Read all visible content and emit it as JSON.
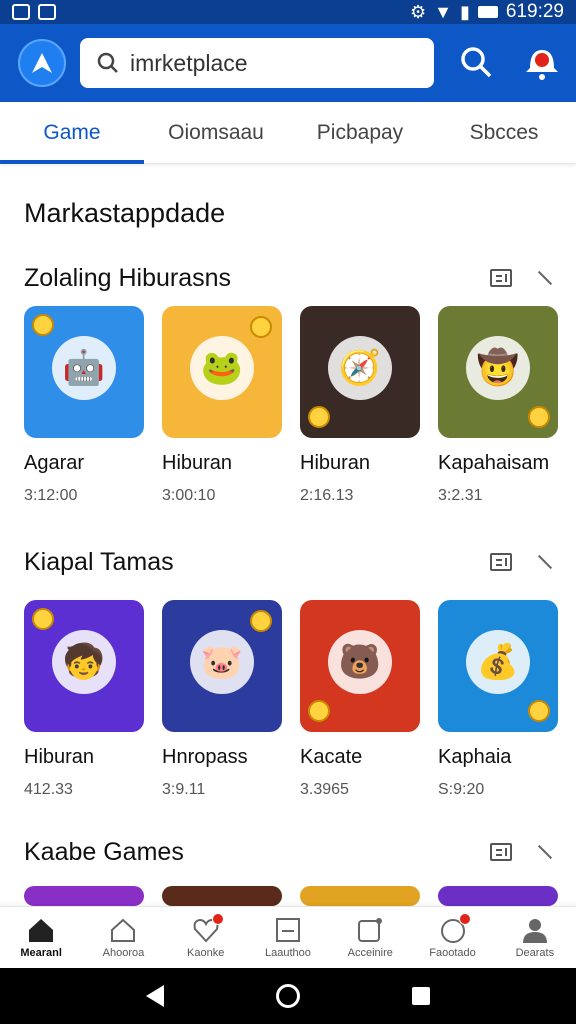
{
  "status_bar": {
    "time": "619:29"
  },
  "search": {
    "placeholder": "imrketplace"
  },
  "tabs": [
    {
      "label": "Game",
      "active": true
    },
    {
      "label": "Oiomsaau",
      "active": false
    },
    {
      "label": "Picbapay",
      "active": false
    },
    {
      "label": "Sbcces",
      "active": false
    }
  ],
  "page_title": "Markastappdade",
  "sections": [
    {
      "title": "Zolaling Hiburasns",
      "cards": [
        {
          "name": "Agarar",
          "meta": "3:12:00",
          "icon": "robot-car-icon",
          "bg": "#2f8ee8"
        },
        {
          "name": "Hiburan",
          "meta": "3:00:10",
          "icon": "yellow-creature-icon",
          "bg": "#f6b63a"
        },
        {
          "name": "Hiburan",
          "meta": "2:16.13",
          "icon": "adventurer-icon",
          "bg": "#3a2a26"
        },
        {
          "name": "Kapahaisam",
          "meta": "3:2.31",
          "icon": "hat-man-icon",
          "bg": "#6b7b34"
        }
      ]
    },
    {
      "title": "Kiapal Tamas",
      "cards": [
        {
          "name": "Hiburan",
          "meta": "412.33",
          "icon": "hero-boy-icon",
          "bg": "#5b2fd1"
        },
        {
          "name": "Hnropass",
          "meta": "3:9.11",
          "icon": "pink-hero-icon",
          "bg": "#2b3b9e"
        },
        {
          "name": "Kacate",
          "meta": "3.3965",
          "icon": "bear-icon",
          "bg": "#d3371f"
        },
        {
          "name": "Kaphaia",
          "meta": "S:9:20",
          "icon": "treasure-crew-icon",
          "bg": "#1c8ad8"
        }
      ]
    },
    {
      "title": "Kaabe Games",
      "cards": [
        {
          "name": "",
          "meta": "",
          "icon": "purple-creature-icon",
          "bg": "#8a2fc6"
        },
        {
          "name": "",
          "meta": "",
          "icon": "dark-hero-icon",
          "bg": "#5a2a1a"
        },
        {
          "name": "",
          "meta": "",
          "icon": "rainbow-icon",
          "bg": "#e1a321"
        },
        {
          "name": "",
          "meta": "",
          "icon": "green-monster-icon",
          "bg": "#6b2fc6"
        }
      ]
    }
  ],
  "bottom_nav": [
    {
      "label": "Mearanl",
      "active": true,
      "badge": false
    },
    {
      "label": "Ahooroa",
      "active": false,
      "badge": false
    },
    {
      "label": "Kaonke",
      "active": false,
      "badge": true
    },
    {
      "label": "Laauthoo",
      "active": false,
      "badge": false
    },
    {
      "label": "Acceinire",
      "active": false,
      "badge": false
    },
    {
      "label": "Faootado",
      "active": false,
      "badge": true
    },
    {
      "label": "Dearats",
      "active": false,
      "badge": false
    }
  ],
  "colors": {
    "primary": "#0d57c7",
    "status_bar": "#0b3f91",
    "badge": "#e2231a"
  }
}
